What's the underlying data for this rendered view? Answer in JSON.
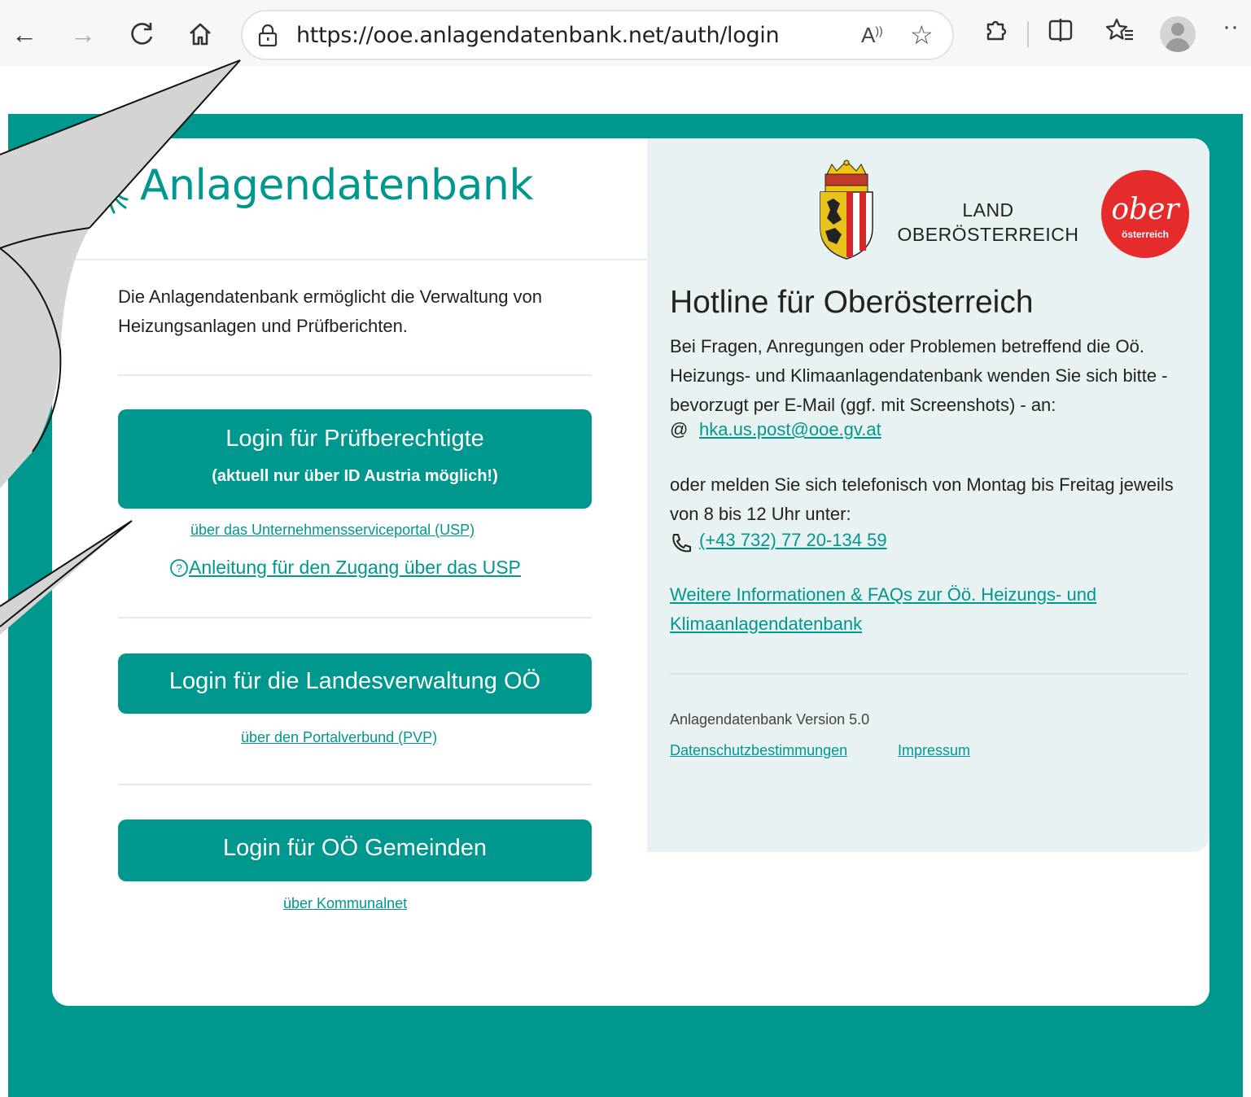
{
  "browser": {
    "url": "https://ooe.anlagendatenbank.net/auth/login",
    "read_aloud": "A̩̩",
    "more": "··"
  },
  "app": {
    "logo_text": "Anlagendatenbank",
    "intro": "Die Anlagendatenbank ermöglicht die Verwaltung von Heizungsanlagen und Prüfberichten."
  },
  "logins": {
    "pruef": {
      "label": "Login für Prüfberechtigte",
      "sub": "(aktuell nur über ID Austria möglich!)",
      "link": "über das Unternehmensserviceportal (USP)",
      "help": " Anleitung für den Zugang über das USP"
    },
    "landes": {
      "label": "Login für die Landesverwaltung OÖ",
      "link": "über den Portalverbund (PVP)"
    },
    "gemeinden": {
      "label": "Login für OÖ Gemeinden",
      "link": "über Kommunalnet"
    }
  },
  "right": {
    "land_line1": "LAND",
    "land_line2": "OBERÖSTERREICH",
    "ober_word": "ober",
    "ober_sub": "österreich",
    "hotline_title": "Hotline für Oberösterreich",
    "hotline_text": "Bei Fragen, Anregungen oder Problemen betreffend die Oö. Heizungs- und Klimaanlagendatenbank wenden Sie sich bitte - bevorzugt per E-Mail (ggf. mit Screenshots) - an:",
    "email": "hka.us.post@ooe.gv.at",
    "phone_text": "oder melden Sie sich telefonisch von Montag bis Freitag jeweils von 8 bis 12 Uhr unter:",
    "phone": "(+43 732) 77 20-134 59",
    "more_info": "Weitere Informationen & FAQs zur Öö. Heizungs- und Klimaanlagendatenbank",
    "version": "Anlagendatenbank Version 5.0",
    "privacy": "Datenschutzbestimmungen ",
    "imprint": "Impressum"
  },
  "colors": {
    "teal": "#00978f",
    "panel": "#e9f2f2",
    "ober_red": "#e52b2b"
  }
}
